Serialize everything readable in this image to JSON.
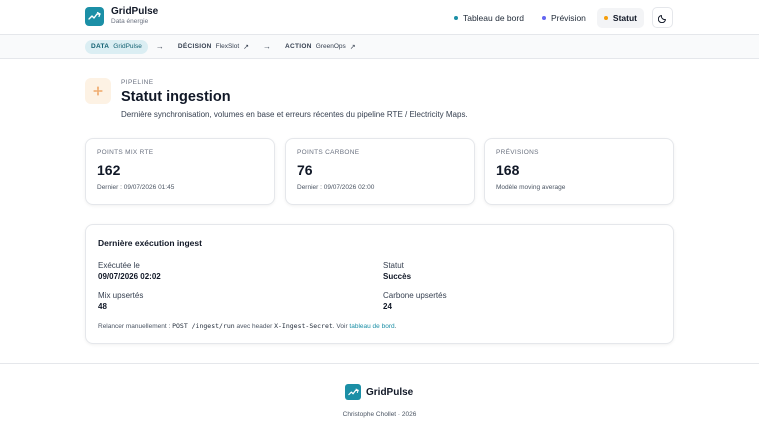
{
  "brand": {
    "name": "GridPulse",
    "subtitle": "Data énergie"
  },
  "nav": {
    "items": [
      {
        "label": "Tableau de bord",
        "dot_color": "#1b8fa6"
      },
      {
        "label": "Prévision",
        "dot_color": "#6366f1"
      },
      {
        "label": "Statut",
        "dot_color": "#f59e0b",
        "active": true
      }
    ],
    "theme_icon": "moon-icon"
  },
  "pipeline": {
    "steps": [
      {
        "kicker": "DATA",
        "label": "GridPulse"
      },
      {
        "kicker": "DÉCISION",
        "label": "FlexSlot",
        "ext": "↗"
      },
      {
        "kicker": "ACTION",
        "label": "GreenOps",
        "ext": "↗"
      }
    ],
    "arrow": "→"
  },
  "page": {
    "kicker": "PIPELINE",
    "title": "Statut ingestion",
    "description": "Dernière synchronisation, volumes en base et erreurs récentes du pipeline RTE / Electricity Maps."
  },
  "stats": [
    {
      "label": "POINTS MIX RTE",
      "value": "162",
      "note": "Dernier : 09/07/2026 01:45"
    },
    {
      "label": "POINTS CARBONE",
      "value": "76",
      "note": "Dernier : 09/07/2026 02:00"
    },
    {
      "label": "PRÉVISIONS",
      "value": "168",
      "note": "Modèle moving average"
    }
  ],
  "run": {
    "title": "Dernière exécution ingest",
    "executed_label": "Exécutée le",
    "executed_value": "09/07/2026 02:02",
    "status_label": "Statut",
    "status_value": "Succès",
    "mix_label": "Mix upsertés",
    "mix_value": "48",
    "carbon_label": "Carbone upsertés",
    "carbon_value": "24",
    "hint_prefix": "Relancer manuellement : ",
    "hint_endpoint": "POST /ingest/run",
    "hint_middle": " avec header ",
    "hint_header": "X-Ingest-Secret",
    "hint_see": ". Voir ",
    "hint_link": "tableau de bord",
    "hint_end": "."
  },
  "footer": {
    "name": "GridPulse",
    "credit": "Christophe Chollet · 2026"
  },
  "colors": {
    "accent": "#1b8fa6",
    "warning_bg": "#fdf2e4",
    "warning": "#e8832a"
  }
}
